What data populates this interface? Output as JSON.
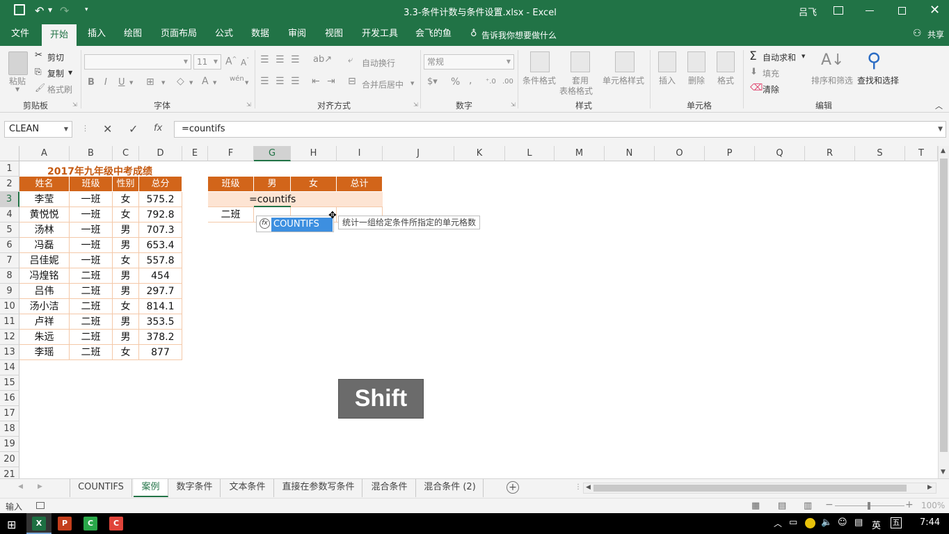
{
  "window": {
    "title": "3.3-条件计数与条件设置.xlsx  -  Excel",
    "user": "吕飞",
    "share": "共享"
  },
  "menu": {
    "tabs": [
      "文件",
      "开始",
      "插入",
      "绘图",
      "页面布局",
      "公式",
      "数据",
      "审阅",
      "视图",
      "开发工具",
      "会飞的鱼"
    ],
    "active": "开始",
    "tell_me": "告诉我你想要做什么"
  },
  "ribbon": {
    "clipboard": {
      "paste": "粘贴",
      "cut": "剪切",
      "copy": "复制",
      "format_painter": "格式刷",
      "label": "剪贴板"
    },
    "font": {
      "size": "11",
      "label": "字体"
    },
    "alignment": {
      "wrap": "自动换行",
      "merge": "合并后居中",
      "label": "对齐方式"
    },
    "number": {
      "format": "常规",
      "label": "数字"
    },
    "styles": {
      "conditional": "条件格式",
      "table1": "套用",
      "table2": "表格格式",
      "cell_styles": "单元格样式",
      "label": "样式"
    },
    "cells": {
      "insert": "插入",
      "delete": "删除",
      "format": "格式",
      "label": "单元格"
    },
    "editing": {
      "autosum": "自动求和",
      "fill": "填充",
      "clear": "清除",
      "sort": "排序和筛选",
      "find": "查找和选择",
      "label": "编辑"
    }
  },
  "formula_bar": {
    "name_box": "CLEAN",
    "formula": "=countifs"
  },
  "columns": [
    "A",
    "B",
    "C",
    "D",
    "E",
    "F",
    "G",
    "H",
    "I",
    "J",
    "K",
    "L",
    "M",
    "N",
    "O",
    "P",
    "Q",
    "R",
    "S",
    "T"
  ],
  "rows": [
    "1",
    "2",
    "3",
    "4",
    "5",
    "6",
    "7",
    "8",
    "9",
    "10",
    "11",
    "12",
    "13",
    "14",
    "15",
    "16",
    "17",
    "18",
    "19",
    "20",
    "21"
  ],
  "sheet": {
    "title": "2017年九年级中考成绩",
    "headers": [
      "姓名",
      "班级",
      "性别",
      "总分"
    ],
    "records": [
      [
        "李莹",
        "一班",
        "女",
        "575.2"
      ],
      [
        "黄悦悦",
        "一班",
        "女",
        "792.8"
      ],
      [
        "汤林",
        "一班",
        "男",
        "707.3"
      ],
      [
        "冯磊",
        "一班",
        "男",
        "653.4"
      ],
      [
        "吕佳妮",
        "一班",
        "女",
        "557.8"
      ],
      [
        "冯煌铭",
        "二班",
        "男",
        "454"
      ],
      [
        "吕伟",
        "二班",
        "男",
        "297.7"
      ],
      [
        "汤小洁",
        "二班",
        "女",
        "814.1"
      ],
      [
        "卢祥",
        "二班",
        "男",
        "353.5"
      ],
      [
        "朱远",
        "二班",
        "男",
        "378.2"
      ],
      [
        "李瑶",
        "二班",
        "女",
        "877"
      ]
    ],
    "summary_headers": [
      "班级",
      "男",
      "女",
      "总计"
    ],
    "summary_row2_class": "二班",
    "editing_text": "=countifs"
  },
  "autocomplete": {
    "item": "COUNTIFS",
    "tooltip": "统计一组给定条件所指定的单元格数"
  },
  "key_overlay": "Shift",
  "sheet_tabs": [
    "COUNTIFS",
    "案例",
    "数字条件",
    "文本条件",
    "直接在参数写条件",
    "混合条件",
    "混合条件 (2)"
  ],
  "active_sheet": "案例",
  "status": {
    "mode": "输入",
    "zoom": "100%"
  },
  "taskbar": {
    "time": "7:44",
    "ime": "英"
  }
}
